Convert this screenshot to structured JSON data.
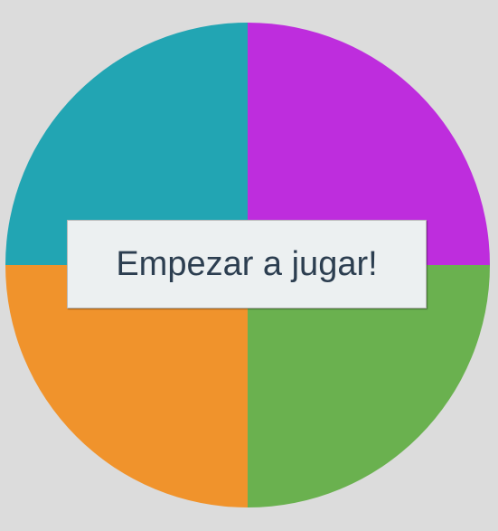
{
  "game": {
    "start_button_label": "Empezar a jugar!",
    "quadrants": [
      {
        "id": "top-left",
        "color": "#22a5b3"
      },
      {
        "id": "top-right",
        "color": "#be2ddd"
      },
      {
        "id": "bottom-left",
        "color": "#f0932c"
      },
      {
        "id": "bottom-right",
        "color": "#6ab14f"
      }
    ],
    "background_color": "#dcdcdc",
    "button_text_color": "#2c3e50"
  }
}
